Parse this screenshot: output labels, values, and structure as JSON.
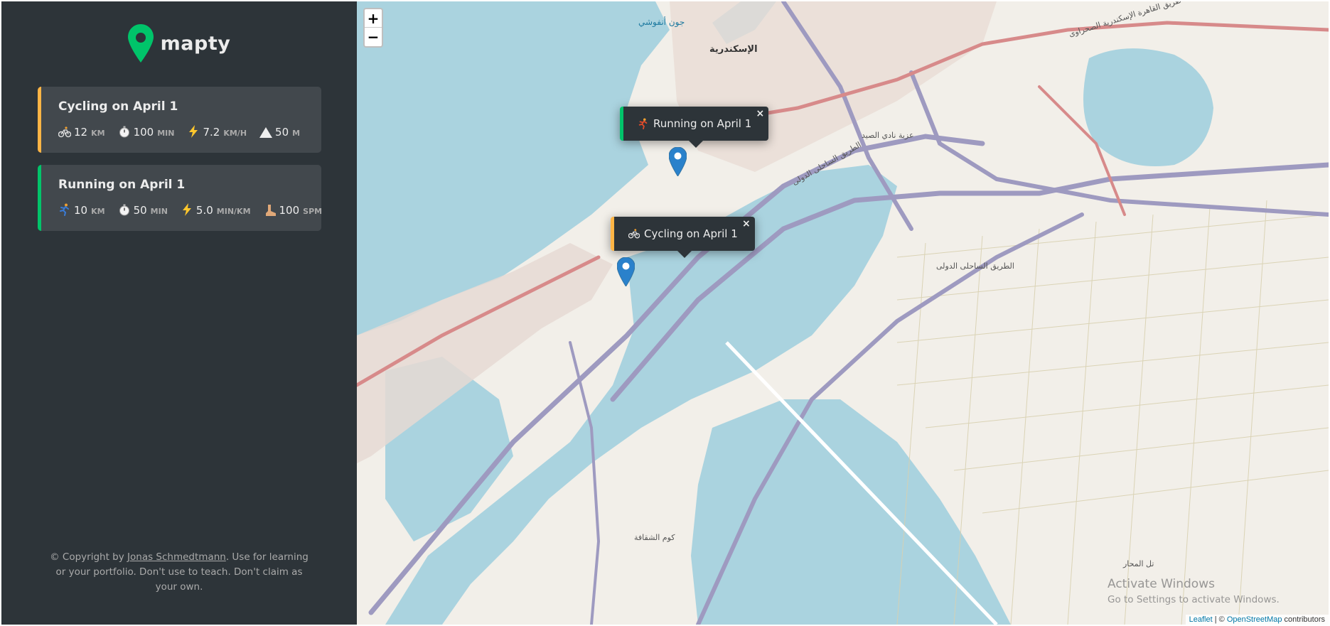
{
  "app": {
    "name": "mapty",
    "brand_color": "#00c46a",
    "cycling_color": "#ffb545",
    "running_color": "#00c46a"
  },
  "workouts": [
    {
      "type": "cycling",
      "title": "Cycling on April 1",
      "icon": "cyclist-icon",
      "details": [
        {
          "icon": "cyclist-icon",
          "value": "12",
          "unit": "km"
        },
        {
          "icon": "stopwatch-icon",
          "value": "100",
          "unit": "min"
        },
        {
          "icon": "lightning-icon",
          "value": "7.2",
          "unit": "km/h"
        },
        {
          "icon": "mountain-icon",
          "value": "50",
          "unit": "m"
        }
      ]
    },
    {
      "type": "running",
      "title": "Running on April 1",
      "icon": "runner-icon",
      "details": [
        {
          "icon": "runner-icon",
          "value": "10",
          "unit": "km"
        },
        {
          "icon": "stopwatch-icon",
          "value": "50",
          "unit": "min"
        },
        {
          "icon": "lightning-icon",
          "value": "5.0",
          "unit": "min/km"
        },
        {
          "icon": "footprint-icon",
          "value": "100",
          "unit": "spm"
        }
      ]
    }
  ],
  "copyright": {
    "prefix": "© Copyright by ",
    "author": "Jonas Schmedtmann",
    "suffix": ". Use for learning or your portfolio. Don't use to teach. Don't claim as your own."
  },
  "map": {
    "zoom_in": "+",
    "zoom_out": "−",
    "popups": [
      {
        "type": "running",
        "label": "Running on April 1",
        "close": "×"
      },
      {
        "type": "cycling",
        "label": "Cycling on April 1",
        "close": "×"
      }
    ],
    "labels": {
      "city": "الإسكندرية",
      "road_1": "الطريق الساحلى الدولى",
      "road_2": "طريق القاهرة الإسكندرية الصحراوى",
      "road_3": "الطريق الساحلى الدولى",
      "place_1": "عزبة نادي الصيد",
      "place_2": "جون أنفوشي",
      "place_3": "كوم الشقافة",
      "place_4": "تل المحار"
    },
    "attribution": {
      "leaflet": "Leaflet",
      "separator": " | © ",
      "osm": "OpenStreetMap",
      "suffix": " contributors"
    }
  },
  "watermark": {
    "title": "Activate Windows",
    "subtitle": "Go to Settings to activate Windows."
  }
}
